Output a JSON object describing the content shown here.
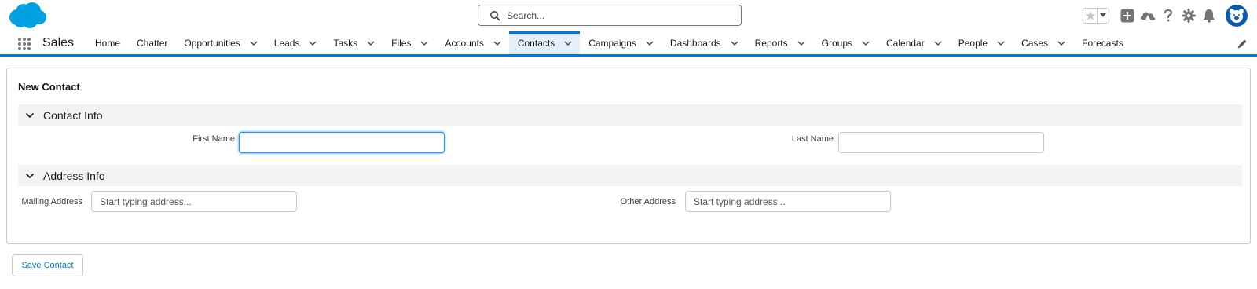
{
  "header": {
    "search_placeholder": "Search...",
    "icons": [
      "salesforce-cloud-logo",
      "favorite-star-icon",
      "favorites-dropdown-icon",
      "global-actions-plus-icon",
      "trailhead-icon",
      "help-icon",
      "setup-gear-icon",
      "notifications-bell-icon",
      "user-avatar"
    ]
  },
  "nav": {
    "app_name": "Sales",
    "items": [
      {
        "label": "Home",
        "has_menu": false,
        "active": false
      },
      {
        "label": "Chatter",
        "has_menu": false,
        "active": false
      },
      {
        "label": "Opportunities",
        "has_menu": true,
        "active": false
      },
      {
        "label": "Leads",
        "has_menu": true,
        "active": false
      },
      {
        "label": "Tasks",
        "has_menu": true,
        "active": false
      },
      {
        "label": "Files",
        "has_menu": true,
        "active": false
      },
      {
        "label": "Accounts",
        "has_menu": true,
        "active": false
      },
      {
        "label": "Contacts",
        "has_menu": true,
        "active": true
      },
      {
        "label": "Campaigns",
        "has_menu": true,
        "active": false
      },
      {
        "label": "Dashboards",
        "has_menu": true,
        "active": false
      },
      {
        "label": "Reports",
        "has_menu": true,
        "active": false
      },
      {
        "label": "Groups",
        "has_menu": true,
        "active": false
      },
      {
        "label": "Calendar",
        "has_menu": true,
        "active": false
      },
      {
        "label": "People",
        "has_menu": true,
        "active": false
      },
      {
        "label": "Cases",
        "has_menu": true,
        "active": false
      },
      {
        "label": "Forecasts",
        "has_menu": false,
        "active": false
      }
    ]
  },
  "form": {
    "title": "New Contact",
    "contact_section": {
      "title": "Contact Info",
      "first_name_label": "First Name",
      "first_name_value": "",
      "last_name_label": "Last Name",
      "last_name_value": ""
    },
    "address_section": {
      "title": "Address Info",
      "mailing_label": "Mailing Address",
      "mailing_placeholder": "Start typing address...",
      "other_label": "Other Address",
      "other_placeholder": "Start typing address..."
    },
    "save_label": "Save Contact"
  },
  "colors": {
    "brand_blue": "#0176d3",
    "logo_blue": "#00a1e0",
    "active_tab_bg": "#e6eff9",
    "section_bg": "#f3f3f3",
    "focus_ring": "#1b96ff"
  }
}
